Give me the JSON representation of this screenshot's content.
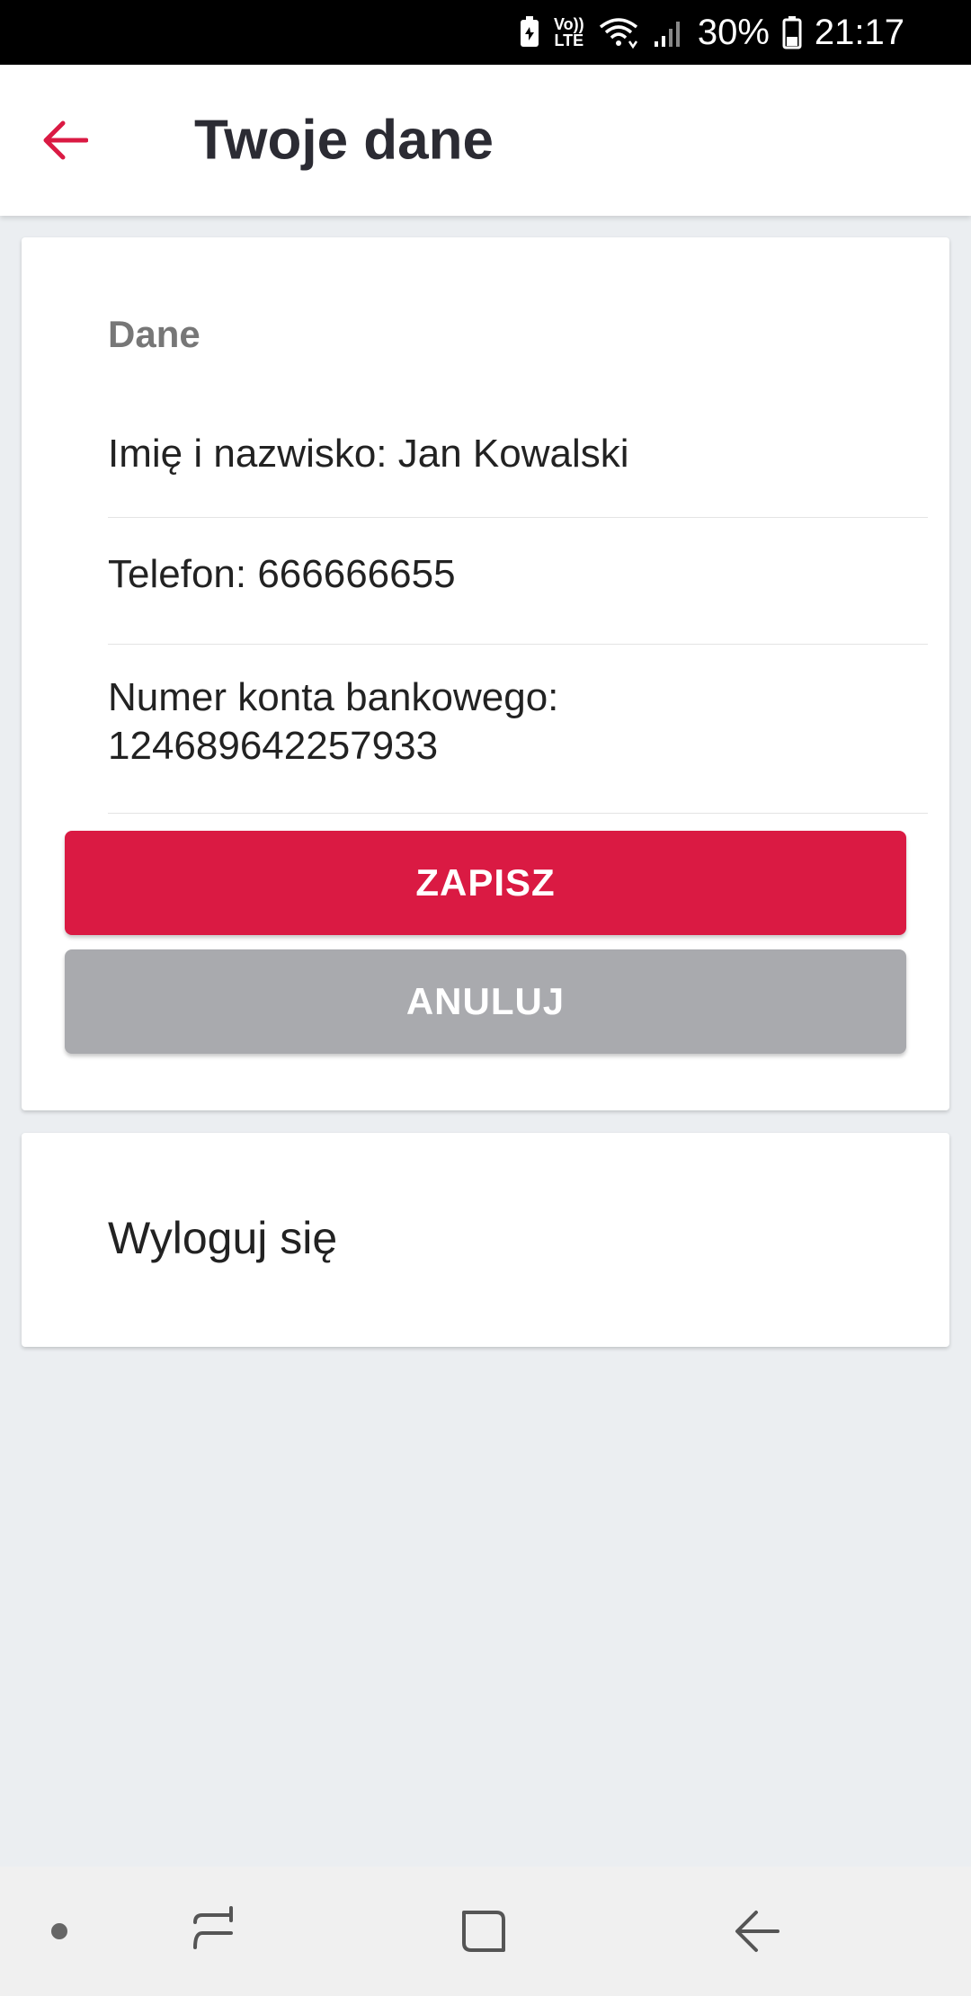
{
  "status_bar": {
    "network_label_top": "Vo))",
    "network_label_bottom": "LTE",
    "battery": "30%",
    "time": "21:17"
  },
  "app_bar": {
    "title": "Twoje dane"
  },
  "data_card": {
    "section_title": "Dane",
    "name_row": "Imię i nazwisko: Jan Kowalski",
    "phone_row": "Telefon: 666666655",
    "account_label": "Numer konta bankowego:",
    "account_number": "124689642257933",
    "save_label": "ZAPISZ",
    "cancel_label": "ANULUJ"
  },
  "logout_card": {
    "label": "Wyloguj się"
  },
  "colors": {
    "accent": "#da1a43",
    "cancel": "#a9aaae",
    "background": "#ebeef1"
  }
}
